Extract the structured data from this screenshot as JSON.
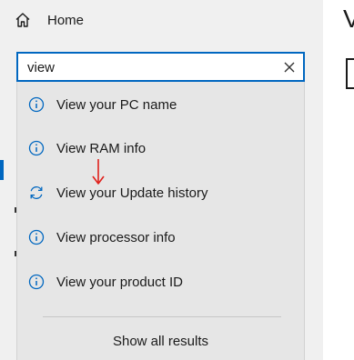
{
  "window": {
    "right_heading_char": "V"
  },
  "nav": {
    "home_label": "Home",
    "home_icon": "home-icon"
  },
  "search": {
    "value": "view",
    "clear_icon": "close-icon"
  },
  "results": [
    {
      "label": "View your PC name",
      "icon": "info-icon"
    },
    {
      "label": "View RAM info",
      "icon": "info-icon"
    },
    {
      "label": "View your Update history",
      "icon": "sync-icon"
    },
    {
      "label": "View processor info",
      "icon": "info-icon"
    },
    {
      "label": "View your product ID",
      "icon": "info-icon"
    }
  ],
  "show_all_label": "Show all results",
  "colors": {
    "accent": "#0067c0",
    "annotation_arrow": "#e0201b",
    "panel_bg": "#e6e6e6",
    "page_bg": "#f0f0f0"
  }
}
